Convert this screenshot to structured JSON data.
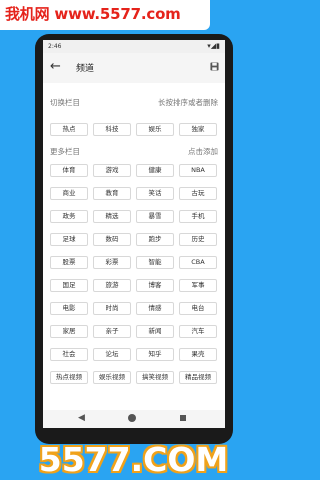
{
  "watermark": {
    "top": "我机网 www.5577.com",
    "bottom": "5577.COM"
  },
  "status_bar": {
    "time": "2:46",
    "icons": "▾◢▮"
  },
  "app_bar": {
    "title": "频道",
    "back_icon": "arrow-left-icon",
    "save_icon": "save-icon"
  },
  "my_channels": {
    "label": "切换栏目",
    "hint": "长按排序或者删除",
    "items": [
      "热点",
      "科技",
      "娱乐",
      "独家"
    ]
  },
  "more_channels": {
    "label": "更多栏目",
    "hint": "点击添加",
    "items": [
      "体育",
      "游戏",
      "健康",
      "NBA",
      "商业",
      "教育",
      "笑话",
      "古玩",
      "政务",
      "精选",
      "暴雪",
      "手机",
      "足球",
      "数码",
      "跑步",
      "历史",
      "股票",
      "彩票",
      "智能",
      "CBA",
      "国足",
      "旅游",
      "博客",
      "军事",
      "电影",
      "时尚",
      "情感",
      "电台",
      "家居",
      "亲子",
      "新闻",
      "汽车",
      "社会",
      "论坛",
      "知乎",
      "果壳",
      "热点视频",
      "娱乐视频",
      "搞笑视频",
      "精品视频"
    ]
  },
  "nav_bar": {
    "back": "◀"
  }
}
